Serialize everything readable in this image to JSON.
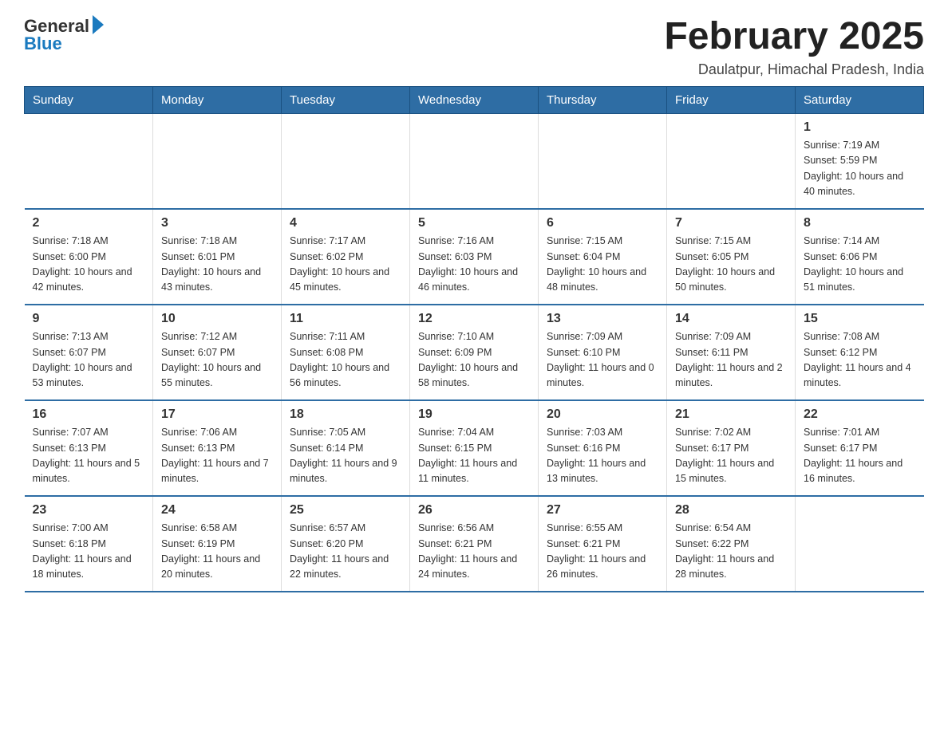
{
  "logo": {
    "general": "General",
    "blue": "Blue"
  },
  "title": "February 2025",
  "location": "Daulatpur, Himachal Pradesh, India",
  "weekdays": [
    "Sunday",
    "Monday",
    "Tuesday",
    "Wednesday",
    "Thursday",
    "Friday",
    "Saturday"
  ],
  "weeks": [
    [
      {
        "day": "",
        "info": ""
      },
      {
        "day": "",
        "info": ""
      },
      {
        "day": "",
        "info": ""
      },
      {
        "day": "",
        "info": ""
      },
      {
        "day": "",
        "info": ""
      },
      {
        "day": "",
        "info": ""
      },
      {
        "day": "1",
        "info": "Sunrise: 7:19 AM\nSunset: 5:59 PM\nDaylight: 10 hours and 40 minutes."
      }
    ],
    [
      {
        "day": "2",
        "info": "Sunrise: 7:18 AM\nSunset: 6:00 PM\nDaylight: 10 hours and 42 minutes."
      },
      {
        "day": "3",
        "info": "Sunrise: 7:18 AM\nSunset: 6:01 PM\nDaylight: 10 hours and 43 minutes."
      },
      {
        "day": "4",
        "info": "Sunrise: 7:17 AM\nSunset: 6:02 PM\nDaylight: 10 hours and 45 minutes."
      },
      {
        "day": "5",
        "info": "Sunrise: 7:16 AM\nSunset: 6:03 PM\nDaylight: 10 hours and 46 minutes."
      },
      {
        "day": "6",
        "info": "Sunrise: 7:15 AM\nSunset: 6:04 PM\nDaylight: 10 hours and 48 minutes."
      },
      {
        "day": "7",
        "info": "Sunrise: 7:15 AM\nSunset: 6:05 PM\nDaylight: 10 hours and 50 minutes."
      },
      {
        "day": "8",
        "info": "Sunrise: 7:14 AM\nSunset: 6:06 PM\nDaylight: 10 hours and 51 minutes."
      }
    ],
    [
      {
        "day": "9",
        "info": "Sunrise: 7:13 AM\nSunset: 6:07 PM\nDaylight: 10 hours and 53 minutes."
      },
      {
        "day": "10",
        "info": "Sunrise: 7:12 AM\nSunset: 6:07 PM\nDaylight: 10 hours and 55 minutes."
      },
      {
        "day": "11",
        "info": "Sunrise: 7:11 AM\nSunset: 6:08 PM\nDaylight: 10 hours and 56 minutes."
      },
      {
        "day": "12",
        "info": "Sunrise: 7:10 AM\nSunset: 6:09 PM\nDaylight: 10 hours and 58 minutes."
      },
      {
        "day": "13",
        "info": "Sunrise: 7:09 AM\nSunset: 6:10 PM\nDaylight: 11 hours and 0 minutes."
      },
      {
        "day": "14",
        "info": "Sunrise: 7:09 AM\nSunset: 6:11 PM\nDaylight: 11 hours and 2 minutes."
      },
      {
        "day": "15",
        "info": "Sunrise: 7:08 AM\nSunset: 6:12 PM\nDaylight: 11 hours and 4 minutes."
      }
    ],
    [
      {
        "day": "16",
        "info": "Sunrise: 7:07 AM\nSunset: 6:13 PM\nDaylight: 11 hours and 5 minutes."
      },
      {
        "day": "17",
        "info": "Sunrise: 7:06 AM\nSunset: 6:13 PM\nDaylight: 11 hours and 7 minutes."
      },
      {
        "day": "18",
        "info": "Sunrise: 7:05 AM\nSunset: 6:14 PM\nDaylight: 11 hours and 9 minutes."
      },
      {
        "day": "19",
        "info": "Sunrise: 7:04 AM\nSunset: 6:15 PM\nDaylight: 11 hours and 11 minutes."
      },
      {
        "day": "20",
        "info": "Sunrise: 7:03 AM\nSunset: 6:16 PM\nDaylight: 11 hours and 13 minutes."
      },
      {
        "day": "21",
        "info": "Sunrise: 7:02 AM\nSunset: 6:17 PM\nDaylight: 11 hours and 15 minutes."
      },
      {
        "day": "22",
        "info": "Sunrise: 7:01 AM\nSunset: 6:17 PM\nDaylight: 11 hours and 16 minutes."
      }
    ],
    [
      {
        "day": "23",
        "info": "Sunrise: 7:00 AM\nSunset: 6:18 PM\nDaylight: 11 hours and 18 minutes."
      },
      {
        "day": "24",
        "info": "Sunrise: 6:58 AM\nSunset: 6:19 PM\nDaylight: 11 hours and 20 minutes."
      },
      {
        "day": "25",
        "info": "Sunrise: 6:57 AM\nSunset: 6:20 PM\nDaylight: 11 hours and 22 minutes."
      },
      {
        "day": "26",
        "info": "Sunrise: 6:56 AM\nSunset: 6:21 PM\nDaylight: 11 hours and 24 minutes."
      },
      {
        "day": "27",
        "info": "Sunrise: 6:55 AM\nSunset: 6:21 PM\nDaylight: 11 hours and 26 minutes."
      },
      {
        "day": "28",
        "info": "Sunrise: 6:54 AM\nSunset: 6:22 PM\nDaylight: 11 hours and 28 minutes."
      },
      {
        "day": "",
        "info": ""
      }
    ]
  ]
}
